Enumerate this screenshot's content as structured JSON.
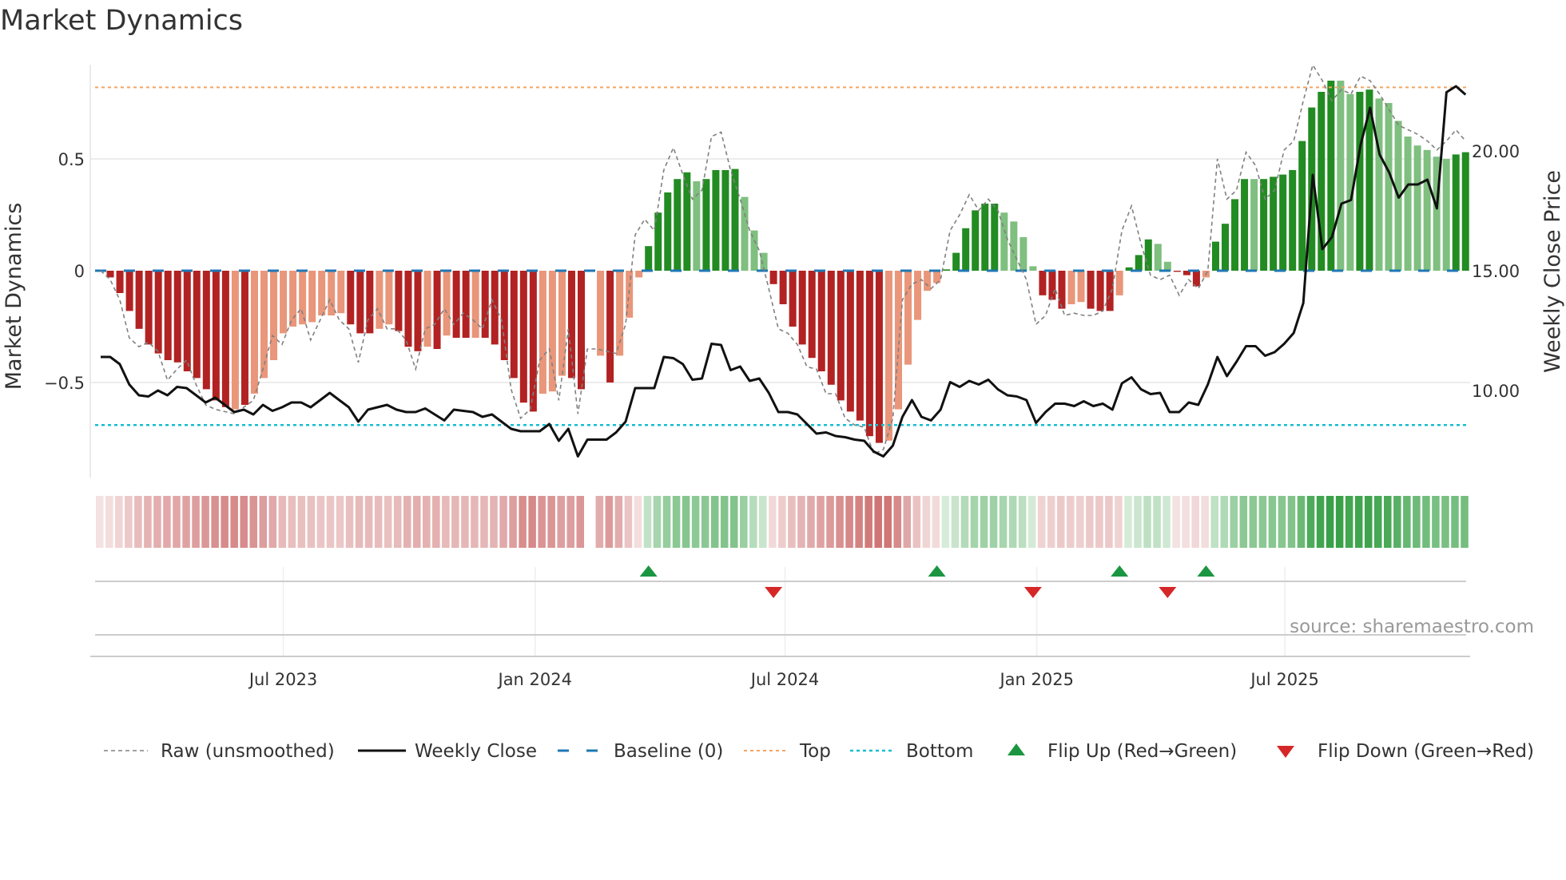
{
  "title": "Market Dynamics",
  "watermark": "source: sharemaestro.com",
  "colors": {
    "bar_neg_dark": "#b22222",
    "bar_neg_light": "#e9967a",
    "bar_pos_dark": "#228b22",
    "bar_pos_light": "#7fbf7f",
    "raw": "#808080",
    "close": "#111111",
    "baseline": "#1f77b4",
    "top": "#f4a460",
    "bottom": "#17becf",
    "flip_up": "#1a9641",
    "flip_down": "#d62728"
  },
  "chart_data": {
    "type": "bar",
    "title": "Market Dynamics",
    "ylabel": "Market Dynamics",
    "y2label": "Weekly Close Price",
    "ylim": [
      -0.86,
      0.92
    ],
    "y2lim": [
      6.9,
      24.2
    ],
    "yticks": [
      {
        "v": 0.5,
        "label": "0.5"
      },
      {
        "v": 0,
        "label": "0"
      },
      {
        "v": -0.5,
        "label": "−0.5"
      }
    ],
    "y2ticks": [
      {
        "v": 20,
        "label": "20.00"
      },
      {
        "v": 15,
        "label": "15.00"
      },
      {
        "v": 10,
        "label": "10.00"
      }
    ],
    "xticks": [
      {
        "week": 19,
        "label": "Jul 2023"
      },
      {
        "week": 45.2,
        "label": "Jan 2024"
      },
      {
        "week": 71.2,
        "label": "Jul 2024"
      },
      {
        "week": 97.4,
        "label": "Jan 2025"
      },
      {
        "week": 123.2,
        "label": "Jul 2025"
      }
    ],
    "top_level": 0.82,
    "bottom_level": -0.69,
    "baseline": 0,
    "dynamics": [
      -0.005,
      -0.03,
      -0.1,
      -0.18,
      -0.26,
      -0.33,
      -0.37,
      -0.4,
      -0.41,
      -0.45,
      -0.48,
      -0.53,
      -0.58,
      -0.61,
      -0.62,
      -0.6,
      -0.55,
      -0.48,
      -0.4,
      -0.28,
      -0.25,
      -0.24,
      -0.23,
      -0.2,
      -0.2,
      -0.19,
      -0.24,
      -0.28,
      -0.28,
      -0.26,
      -0.24,
      -0.27,
      -0.34,
      -0.36,
      -0.34,
      -0.35,
      -0.29,
      -0.3,
      -0.3,
      -0.3,
      -0.3,
      -0.33,
      -0.4,
      -0.48,
      -0.59,
      -0.63,
      -0.55,
      -0.54,
      -0.47,
      -0.48,
      -0.53,
      null,
      -0.38,
      -0.5,
      -0.38,
      -0.21,
      -0.03,
      0.11,
      0.26,
      0.35,
      0.41,
      0.44,
      0.4,
      0.41,
      0.45,
      0.45,
      0.455,
      0.33,
      0.18,
      0.08,
      -0.06,
      -0.15,
      -0.25,
      -0.33,
      -0.39,
      -0.45,
      -0.51,
      -0.58,
      -0.63,
      -0.67,
      -0.74,
      -0.77,
      -0.76,
      -0.62,
      -0.42,
      -0.22,
      -0.09,
      -0.055,
      0.006,
      0.08,
      0.19,
      0.27,
      0.3,
      0.3,
      0.26,
      0.22,
      0.15,
      0.02,
      -0.11,
      -0.13,
      -0.17,
      -0.15,
      -0.14,
      -0.17,
      -0.18,
      -0.18,
      -0.11,
      0.015,
      0.07,
      0.14,
      0.12,
      0.04,
      -0.005,
      -0.02,
      -0.07,
      -0.03,
      0.13,
      0.21,
      0.32,
      0.41,
      0.41,
      0.41,
      0.42,
      0.43,
      0.45,
      0.58,
      0.73,
      0.8,
      0.85,
      0.85,
      0.79,
      0.8,
      0.81,
      0.77,
      0.75,
      0.67,
      0.6,
      0.56,
      0.54,
      0.51,
      0.5,
      0.52,
      0.53
    ],
    "shades": "DDDDDDDDDDDDDDLDLLLLLLLLLLDDDLLDDDLDLDDLDDDDDDLLLDD-LDLLLDDDDDLDDDDLLLDDDDDDDDDDDDLLLLLLDDDDDDLLLLDDDLLDDDLDDDLLDDDLDDDDLDDDDDDDDLLDDLLLLLLLLDD",
    "raw": [
      0,
      -0.04,
      -0.13,
      -0.3,
      -0.34,
      -0.32,
      -0.36,
      -0.49,
      -0.44,
      -0.4,
      -0.51,
      -0.6,
      -0.62,
      -0.63,
      -0.64,
      -0.61,
      -0.58,
      -0.44,
      -0.29,
      -0.33,
      -0.22,
      -0.17,
      -0.31,
      -0.22,
      -0.13,
      -0.22,
      -0.26,
      -0.41,
      -0.22,
      -0.17,
      -0.26,
      -0.26,
      -0.31,
      -0.44,
      -0.26,
      -0.24,
      -0.17,
      -0.24,
      -0.19,
      -0.22,
      -0.26,
      -0.13,
      -0.22,
      -0.53,
      -0.66,
      -0.62,
      -0.4,
      -0.35,
      -0.58,
      -0.26,
      -0.64,
      -0.35,
      -0.35,
      -0.36,
      -0.37,
      -0.24,
      0.16,
      0.23,
      0.18,
      0.45,
      0.55,
      0.43,
      0.32,
      0.36,
      0.6,
      0.62,
      0.45,
      0.32,
      0.18,
      0.09,
      -0.08,
      -0.26,
      -0.28,
      -0.33,
      -0.43,
      -0.44,
      -0.55,
      -0.55,
      -0.66,
      -0.69,
      -0.7,
      -0.82,
      -0.8,
      -0.66,
      -0.13,
      -0.06,
      -0.04,
      -0.08,
      -0.04,
      0.18,
      0.25,
      0.34,
      0.27,
      0.32,
      0.27,
      0.14,
      0.05,
      -0.04,
      -0.24,
      -0.2,
      -0.08,
      -0.2,
      -0.19,
      -0.2,
      -0.2,
      -0.18,
      -0.08,
      0.18,
      0.29,
      0.12,
      -0.02,
      -0.04,
      -0.02,
      -0.11,
      -0.04,
      -0.08,
      0.0,
      0.5,
      0.32,
      0.36,
      0.53,
      0.47,
      0.32,
      0.36,
      0.54,
      0.58,
      0.76,
      0.92,
      0.85,
      0.76,
      0.81,
      0.79,
      0.87,
      0.85,
      0.79,
      0.72,
      0.65,
      0.63,
      0.61,
      0.58,
      0.54,
      0.58,
      0.63,
      0.58
    ],
    "close": [
      11.4,
      11.4,
      11.1,
      10.25,
      9.8,
      9.75,
      10.0,
      9.8,
      10.15,
      10.1,
      9.8,
      9.5,
      9.7,
      9.4,
      9.1,
      9.2,
      9.0,
      9.4,
      9.15,
      9.3,
      9.5,
      9.5,
      9.3,
      9.6,
      9.9,
      9.6,
      9.3,
      8.7,
      9.2,
      9.3,
      9.4,
      9.2,
      9.1,
      9.1,
      9.25,
      9.0,
      8.75,
      9.2,
      9.15,
      9.1,
      8.9,
      9.0,
      8.7,
      8.4,
      8.3,
      8.3,
      8.3,
      8.6,
      7.9,
      8.4,
      7.25,
      7.95,
      7.95,
      7.95,
      8.25,
      8.7,
      10.1,
      10.1,
      10.1,
      11.4,
      11.35,
      11.1,
      10.45,
      10.5,
      11.95,
      11.9,
      10.85,
      11.0,
      10.4,
      10.5,
      9.9,
      9.1,
      9.1,
      9.0,
      8.6,
      8.2,
      8.25,
      8.1,
      8.05,
      7.95,
      7.9,
      7.45,
      7.25,
      7.7,
      8.9,
      9.6,
      8.9,
      8.75,
      9.2,
      10.35,
      10.15,
      10.4,
      10.25,
      10.45,
      10.05,
      9.8,
      9.75,
      9.6,
      8.65,
      9.1,
      9.45,
      9.45,
      9.35,
      9.55,
      9.35,
      9.45,
      9.2,
      10.3,
      10.55,
      10.05,
      9.85,
      9.9,
      9.1,
      9.1,
      9.5,
      9.4,
      10.25,
      11.4,
      10.6,
      11.2,
      11.85,
      11.85,
      11.45,
      11.6,
      11.95,
      12.4,
      13.65,
      19.0,
      15.9,
      16.4,
      17.8,
      17.95,
      20.25,
      21.8,
      19.85,
      19.1,
      18.05,
      18.6,
      18.6,
      18.8,
      17.6,
      22.45,
      22.7,
      22.35
    ],
    "flips_up": [
      57,
      87,
      106,
      115
    ],
    "flips_down": [
      70,
      97,
      111
    ],
    "legend": [
      {
        "key": "raw",
        "label": "Raw (unsmoothed)"
      },
      {
        "key": "close",
        "label": "Weekly Close"
      },
      {
        "key": "baseline",
        "label": "Baseline (0)"
      },
      {
        "key": "top",
        "label": "Top"
      },
      {
        "key": "bottom",
        "label": "Bottom"
      },
      {
        "key": "flip_up",
        "label": "Flip Up (Red→Green)"
      },
      {
        "key": "flip_down",
        "label": "Flip Down (Green→Red)"
      }
    ],
    "legend_position": "bottom"
  }
}
